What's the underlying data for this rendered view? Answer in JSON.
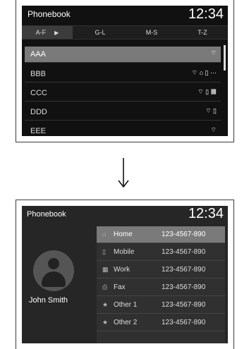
{
  "screen1": {
    "title": "Phonebook",
    "clock": "12:34",
    "tabs": [
      {
        "label": "A-F",
        "arrow": "▶"
      },
      {
        "label": "G-L"
      },
      {
        "label": "M-S"
      },
      {
        "label": "T-Z"
      }
    ],
    "rows": [
      {
        "name": "AAA",
        "icons": "⌔"
      },
      {
        "name": "BBB",
        "icons": "⌔ ⌂ ▯ ⋯"
      },
      {
        "name": "CCC",
        "icons": "⌔ ▯ ▦"
      },
      {
        "name": "DDD",
        "icons": "⌔ ▯"
      },
      {
        "name": "EEE",
        "icons": "⌔"
      }
    ]
  },
  "screen2": {
    "title": "Phonebook",
    "clock": "12:34",
    "contact_name": "John Smith",
    "entries": [
      {
        "icon": "⌂",
        "label": "Home",
        "number": "123-4567-890"
      },
      {
        "icon": "▯",
        "label": "Mobile",
        "number": "123-4567-890"
      },
      {
        "icon": "▦",
        "label": "Work",
        "number": "123-4567-890"
      },
      {
        "icon": "⎙",
        "label": "Fax",
        "number": "123-4567-890"
      },
      {
        "icon": "★",
        "label": "Other 1",
        "number": "123-4567-890"
      },
      {
        "icon": "★",
        "label": "Other 2",
        "number": "123-4567-890"
      }
    ]
  }
}
